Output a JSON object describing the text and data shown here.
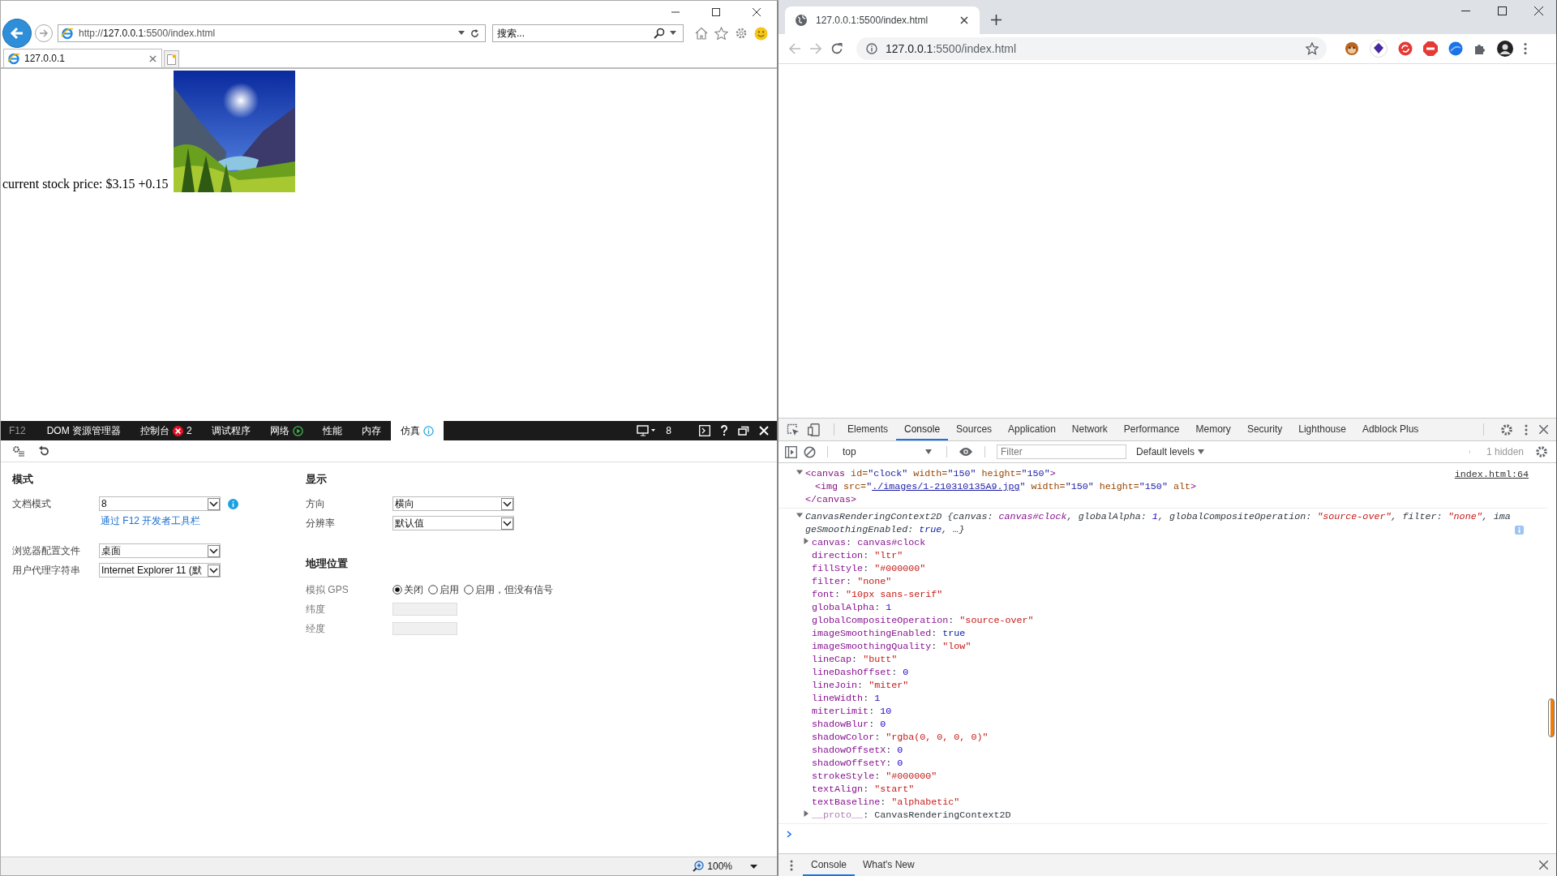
{
  "ie": {
    "address": {
      "url": [
        {
          "text": "http://",
          "strong": false
        },
        {
          "text": "127.0.0.1",
          "strong": true
        },
        {
          "text": ":5500/index.html",
          "strong": false
        }
      ]
    },
    "search": {
      "placeholder": "搜索..."
    },
    "tabs": [
      {
        "title": "127.0.0.1",
        "selected": true
      }
    ],
    "page": {
      "text": "current stock price: $3.15 +0.15"
    },
    "devtools": {
      "label": "F12",
      "tabs": [
        {
          "label": "DOM 资源管理器",
          "selected": false,
          "kind": "plain"
        },
        {
          "label": "控制台",
          "selected": false,
          "kind": "errors",
          "badge": "2"
        },
        {
          "label": "调试程序",
          "selected": false,
          "kind": "plain"
        },
        {
          "label": "网络",
          "selected": false,
          "kind": "network"
        },
        {
          "label": "性能",
          "selected": false,
          "kind": "plain"
        },
        {
          "label": "内存",
          "selected": false,
          "kind": "plain"
        },
        {
          "label": "仿真",
          "selected": true,
          "kind": "info"
        }
      ],
      "doc_mode_badge": "8",
      "mode": {
        "title": "模式",
        "rows": [
          {
            "label": "文档模式",
            "value": "8",
            "info": true,
            "link": "通过 F12 开发者工具栏"
          },
          {
            "label": "浏览器配置文件",
            "value": "桌面",
            "info": false
          },
          {
            "label": "用户代理字符串",
            "value": "Internet Explorer 11 (默",
            "info": false
          }
        ]
      },
      "display": {
        "title": "显示",
        "rows": [
          {
            "label": "方向",
            "value": "横向"
          },
          {
            "label": "分辨率",
            "value": "默认值"
          }
        ]
      },
      "geolocation": {
        "title": "地理位置",
        "gps": {
          "label": "模拟 GPS",
          "options": [
            {
              "label": "关闭",
              "selected": true
            },
            {
              "label": "启用",
              "selected": false
            },
            {
              "label": "启用，但没有信号",
              "selected": false
            }
          ]
        },
        "fields": [
          {
            "label": "纬度",
            "disabled": true
          },
          {
            "label": "经度",
            "disabled": true
          }
        ]
      }
    },
    "status_bar": {
      "zoom": "100%"
    }
  },
  "chrome": {
    "tabs": [
      {
        "title": "127.0.0.1:5500/index.html",
        "selected": true
      }
    ],
    "omnibox": {
      "url": [
        {
          "text": "127.0.0.1",
          "strong": true
        },
        {
          "text": ":5500/index.html",
          "strong": false
        }
      ]
    },
    "devtools": {
      "tabs": [
        {
          "label": "Elements",
          "selected": false
        },
        {
          "label": "Console",
          "selected": true
        },
        {
          "label": "Sources",
          "selected": false
        },
        {
          "label": "Application",
          "selected": false
        },
        {
          "label": "Network",
          "selected": false
        },
        {
          "label": "Performance",
          "selected": false
        },
        {
          "label": "Memory",
          "selected": false
        },
        {
          "label": "Security",
          "selected": false
        },
        {
          "label": "Lighthouse",
          "selected": false
        },
        {
          "label": "Adblock Plus",
          "selected": false
        }
      ],
      "console_toolbar": {
        "context": "top",
        "filter_placeholder": "Filter",
        "levels": "Default levels",
        "hidden": "1 hidden"
      },
      "console": {
        "entries": [
          {
            "kind": "element",
            "expanded": true,
            "source": "index.html:64",
            "tokens": [
              {
                "kind": "tag",
                "text": "<canvas"
              },
              {
                "kind": "attr",
                "text": " id="
              },
              {
                "kind": "value",
                "text": "\"clock\""
              },
              {
                "kind": "attr",
                "text": " width="
              },
              {
                "kind": "value",
                "text": "\"150\""
              },
              {
                "kind": "attr",
                "text": " height="
              },
              {
                "kind": "value",
                "text": "\"150\""
              },
              {
                "kind": "tag",
                "text": ">"
              }
            ],
            "children": [
              {
                "expandable": false,
                "tokens": [
                  {
                    "kind": "tag",
                    "text": "<img"
                  },
                  {
                    "kind": "attr",
                    "text": " src="
                  },
                  {
                    "kind": "value",
                    "text": "\""
                  },
                  {
                    "kind": "link",
                    "text": "./images/1-210310135A9.jpg"
                  },
                  {
                    "kind": "value",
                    "text": "\""
                  },
                  {
                    "kind": "attr",
                    "text": " width="
                  },
                  {
                    "kind": "value",
                    "text": "\"150\""
                  },
                  {
                    "kind": "attr",
                    "text": " height="
                  },
                  {
                    "kind": "value",
                    "text": "\"150\""
                  },
                  {
                    "kind": "attr",
                    "text": " alt"
                  },
                  {
                    "kind": "tag",
                    "text": ">"
                  }
                ]
              }
            ],
            "close_tokens": [
              {
                "kind": "tag",
                "text": "</canvas>"
              }
            ]
          },
          {
            "kind": "object",
            "expanded": true,
            "tokens": [
              {
                "kind": "plain",
                "text": "CanvasRenderingContext2D {"
              },
              {
                "kind": "pkey",
                "text": "canvas: "
              },
              {
                "kind": "key",
                "text": "canvas#clock"
              },
              {
                "kind": "plain",
                "text": ", "
              },
              {
                "kind": "pkey",
                "text": "globalAlpha: "
              },
              {
                "kind": "number",
                "text": "1"
              },
              {
                "kind": "plain",
                "text": ", "
              },
              {
                "kind": "pkey",
                "text": "globalCompositeOperation: "
              },
              {
                "kind": "string",
                "text": "\"source-over\""
              },
              {
                "kind": "plain",
                "text": ", "
              },
              {
                "kind": "pkey",
                "text": "filter: "
              },
              {
                "kind": "string",
                "text": "\"none\""
              },
              {
                "kind": "plain",
                "text": ", "
              },
              {
                "kind": "pkey",
                "text": "imageSmoothingEnabled: "
              },
              {
                "kind": "keyword",
                "text": "true"
              },
              {
                "kind": "plain",
                "text": ", …}"
              }
            ],
            "children": [
              {
                "expandable": true,
                "expanded": false,
                "tokens": [
                  {
                    "kind": "key",
                    "text": "canvas"
                  },
                  {
                    "kind": "plain",
                    "text": ": "
                  },
                  {
                    "kind": "key",
                    "text": "canvas#clock"
                  }
                ]
              },
              {
                "expandable": false,
                "tokens": [
                  {
                    "kind": "key",
                    "text": "direction"
                  },
                  {
                    "kind": "plain",
                    "text": ": "
                  },
                  {
                    "kind": "string",
                    "text": "\"ltr\""
                  }
                ]
              },
              {
                "expandable": false,
                "tokens": [
                  {
                    "kind": "key",
                    "text": "fillStyle"
                  },
                  {
                    "kind": "plain",
                    "text": ": "
                  },
                  {
                    "kind": "string",
                    "text": "\"#000000\""
                  }
                ]
              },
              {
                "expandable": false,
                "tokens": [
                  {
                    "kind": "key",
                    "text": "filter"
                  },
                  {
                    "kind": "plain",
                    "text": ": "
                  },
                  {
                    "kind": "string",
                    "text": "\"none\""
                  }
                ]
              },
              {
                "expandable": false,
                "tokens": [
                  {
                    "kind": "key",
                    "text": "font"
                  },
                  {
                    "kind": "plain",
                    "text": ": "
                  },
                  {
                    "kind": "string",
                    "text": "\"10px sans-serif\""
                  }
                ]
              },
              {
                "expandable": false,
                "tokens": [
                  {
                    "kind": "key",
                    "text": "globalAlpha"
                  },
                  {
                    "kind": "plain",
                    "text": ": "
                  },
                  {
                    "kind": "number",
                    "text": "1"
                  }
                ]
              },
              {
                "expandable": false,
                "tokens": [
                  {
                    "kind": "key",
                    "text": "globalCompositeOperation"
                  },
                  {
                    "kind": "plain",
                    "text": ": "
                  },
                  {
                    "kind": "string",
                    "text": "\"source-over\""
                  }
                ]
              },
              {
                "expandable": false,
                "tokens": [
                  {
                    "kind": "key",
                    "text": "imageSmoothingEnabled"
                  },
                  {
                    "kind": "plain",
                    "text": ": "
                  },
                  {
                    "kind": "keyword",
                    "text": "true"
                  }
                ]
              },
              {
                "expandable": false,
                "tokens": [
                  {
                    "kind": "key",
                    "text": "imageSmoothingQuality"
                  },
                  {
                    "kind": "plain",
                    "text": ": "
                  },
                  {
                    "kind": "string",
                    "text": "\"low\""
                  }
                ]
              },
              {
                "expandable": false,
                "tokens": [
                  {
                    "kind": "key",
                    "text": "lineCap"
                  },
                  {
                    "kind": "plain",
                    "text": ": "
                  },
                  {
                    "kind": "string",
                    "text": "\"butt\""
                  }
                ]
              },
              {
                "expandable": false,
                "tokens": [
                  {
                    "kind": "key",
                    "text": "lineDashOffset"
                  },
                  {
                    "kind": "plain",
                    "text": ": "
                  },
                  {
                    "kind": "number",
                    "text": "0"
                  }
                ]
              },
              {
                "expandable": false,
                "tokens": [
                  {
                    "kind": "key",
                    "text": "lineJoin"
                  },
                  {
                    "kind": "plain",
                    "text": ": "
                  },
                  {
                    "kind": "string",
                    "text": "\"miter\""
                  }
                ]
              },
              {
                "expandable": false,
                "tokens": [
                  {
                    "kind": "key",
                    "text": "lineWidth"
                  },
                  {
                    "kind": "plain",
                    "text": ": "
                  },
                  {
                    "kind": "number",
                    "text": "1"
                  }
                ]
              },
              {
                "expandable": false,
                "tokens": [
                  {
                    "kind": "key",
                    "text": "miterLimit"
                  },
                  {
                    "kind": "plain",
                    "text": ": "
                  },
                  {
                    "kind": "number",
                    "text": "10"
                  }
                ]
              },
              {
                "expandable": false,
                "tokens": [
                  {
                    "kind": "key",
                    "text": "shadowBlur"
                  },
                  {
                    "kind": "plain",
                    "text": ": "
                  },
                  {
                    "kind": "number",
                    "text": "0"
                  }
                ]
              },
              {
                "expandable": false,
                "tokens": [
                  {
                    "kind": "key",
                    "text": "shadowColor"
                  },
                  {
                    "kind": "plain",
                    "text": ": "
                  },
                  {
                    "kind": "string",
                    "text": "\"rgba(0, 0, 0, 0)\""
                  }
                ]
              },
              {
                "expandable": false,
                "tokens": [
                  {
                    "kind": "key",
                    "text": "shadowOffsetX"
                  },
                  {
                    "kind": "plain",
                    "text": ": "
                  },
                  {
                    "kind": "number",
                    "text": "0"
                  }
                ]
              },
              {
                "expandable": false,
                "tokens": [
                  {
                    "kind": "key",
                    "text": "shadowOffsetY"
                  },
                  {
                    "kind": "plain",
                    "text": ": "
                  },
                  {
                    "kind": "number",
                    "text": "0"
                  }
                ]
              },
              {
                "expandable": false,
                "tokens": [
                  {
                    "kind": "key",
                    "text": "strokeStyle"
                  },
                  {
                    "kind": "plain",
                    "text": ": "
                  },
                  {
                    "kind": "string",
                    "text": "\"#000000\""
                  }
                ]
              },
              {
                "expandable": false,
                "tokens": [
                  {
                    "kind": "key",
                    "text": "textAlign"
                  },
                  {
                    "kind": "plain",
                    "text": ": "
                  },
                  {
                    "kind": "string",
                    "text": "\"start\""
                  }
                ]
              },
              {
                "expandable": false,
                "tokens": [
                  {
                    "kind": "key",
                    "text": "textBaseline"
                  },
                  {
                    "kind": "plain",
                    "text": ": "
                  },
                  {
                    "kind": "string",
                    "text": "\"alphabetic\""
                  }
                ]
              },
              {
                "expandable": true,
                "expanded": false,
                "tokens": [
                  {
                    "kind": "fkey",
                    "text": "__proto__"
                  },
                  {
                    "kind": "plain",
                    "text": ": CanvasRenderingContext2D"
                  }
                ]
              }
            ]
          }
        ]
      },
      "drawer_tabs": [
        {
          "label": "Console",
          "selected": true
        },
        {
          "label": "What's New",
          "selected": false
        }
      ]
    }
  }
}
